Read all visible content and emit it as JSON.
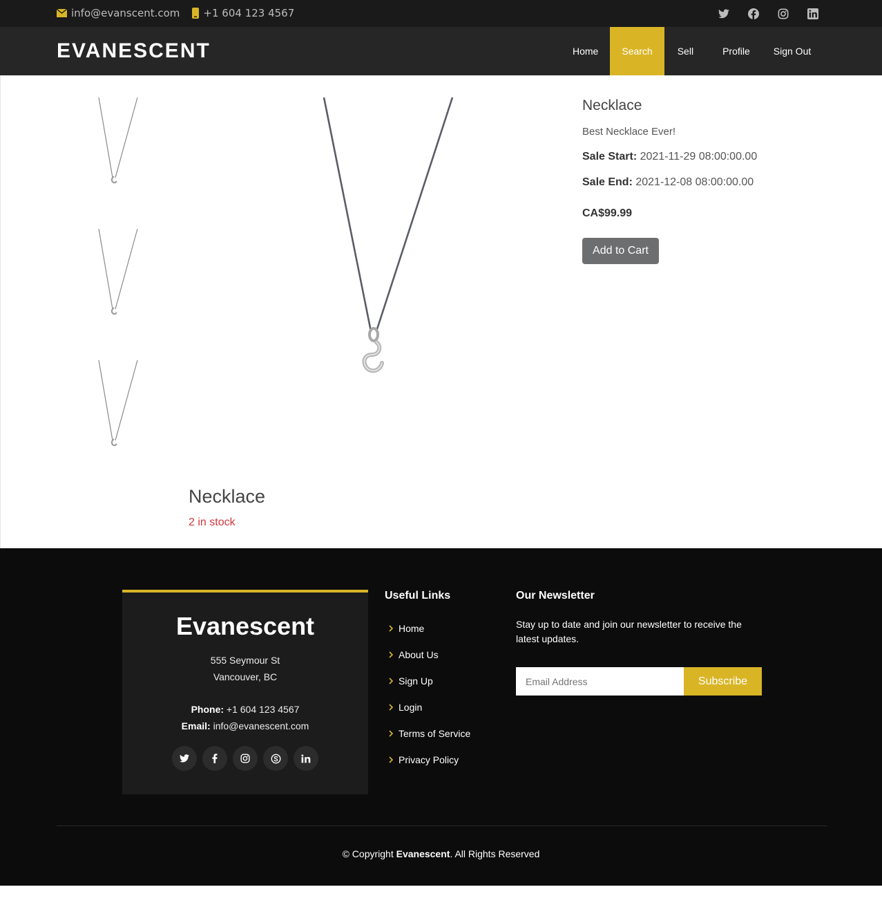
{
  "topbar": {
    "email": "info@evanscent.com",
    "phone": "+1 604 123 4567",
    "social_icons": [
      "twitter-icon",
      "facebook-icon",
      "instagram-icon",
      "linkedin-icon"
    ]
  },
  "header": {
    "logo": "EVANESCENT",
    "nav": [
      {
        "label": "Home",
        "active": false
      },
      {
        "label": "Search",
        "active": true
      },
      {
        "label": "Sell",
        "active": false
      },
      {
        "label": "Profile",
        "active": false
      },
      {
        "label": "Sign Out",
        "active": false
      }
    ]
  },
  "product": {
    "title": "Necklace",
    "description": "Best Necklace Ever!",
    "sale_start_label": "Sale Start:",
    "sale_start": "2021-11-29 08:00:00.00",
    "sale_end_label": "Sale End:",
    "sale_end": "2021-12-08 08:00:00.00",
    "price": "CA$99.99",
    "add_to_cart": "Add to Cart",
    "sub_title": "Necklace",
    "stock": "2 in stock"
  },
  "footer": {
    "brand": "Evanescent",
    "address_line1": "555 Seymour St",
    "address_line2": "Vancouver, BC",
    "phone_label": "Phone:",
    "phone": "+1 604 123 4567",
    "email_label": "Email:",
    "email": "info@evanescent.com",
    "social_icons": [
      "twitter-icon",
      "facebook-icon",
      "instagram-icon",
      "skype-icon",
      "linkedin-icon"
    ],
    "useful_links_heading": "Useful Links",
    "useful_links": [
      "Home",
      "About Us",
      "Sign Up",
      "Login",
      "Terms of Service",
      "Privacy Policy"
    ],
    "newsletter_heading": "Our Newsletter",
    "newsletter_text": "Stay up to date and join our newsletter to receive the latest updates.",
    "email_placeholder": "Email Address",
    "subscribe": "Subscribe",
    "copyright_prefix": "© Copyright",
    "copyright_brand": "Evanescent",
    "copyright_suffix": ". All Rights Reserved"
  },
  "colors": {
    "accent": "#d9b526",
    "topbar_bg": "#1a1a1a",
    "header_bg": "#262626",
    "footer_bg": "#0c0c0c",
    "stock_red": "#d0363c",
    "button_gray": "#6c6e70"
  }
}
